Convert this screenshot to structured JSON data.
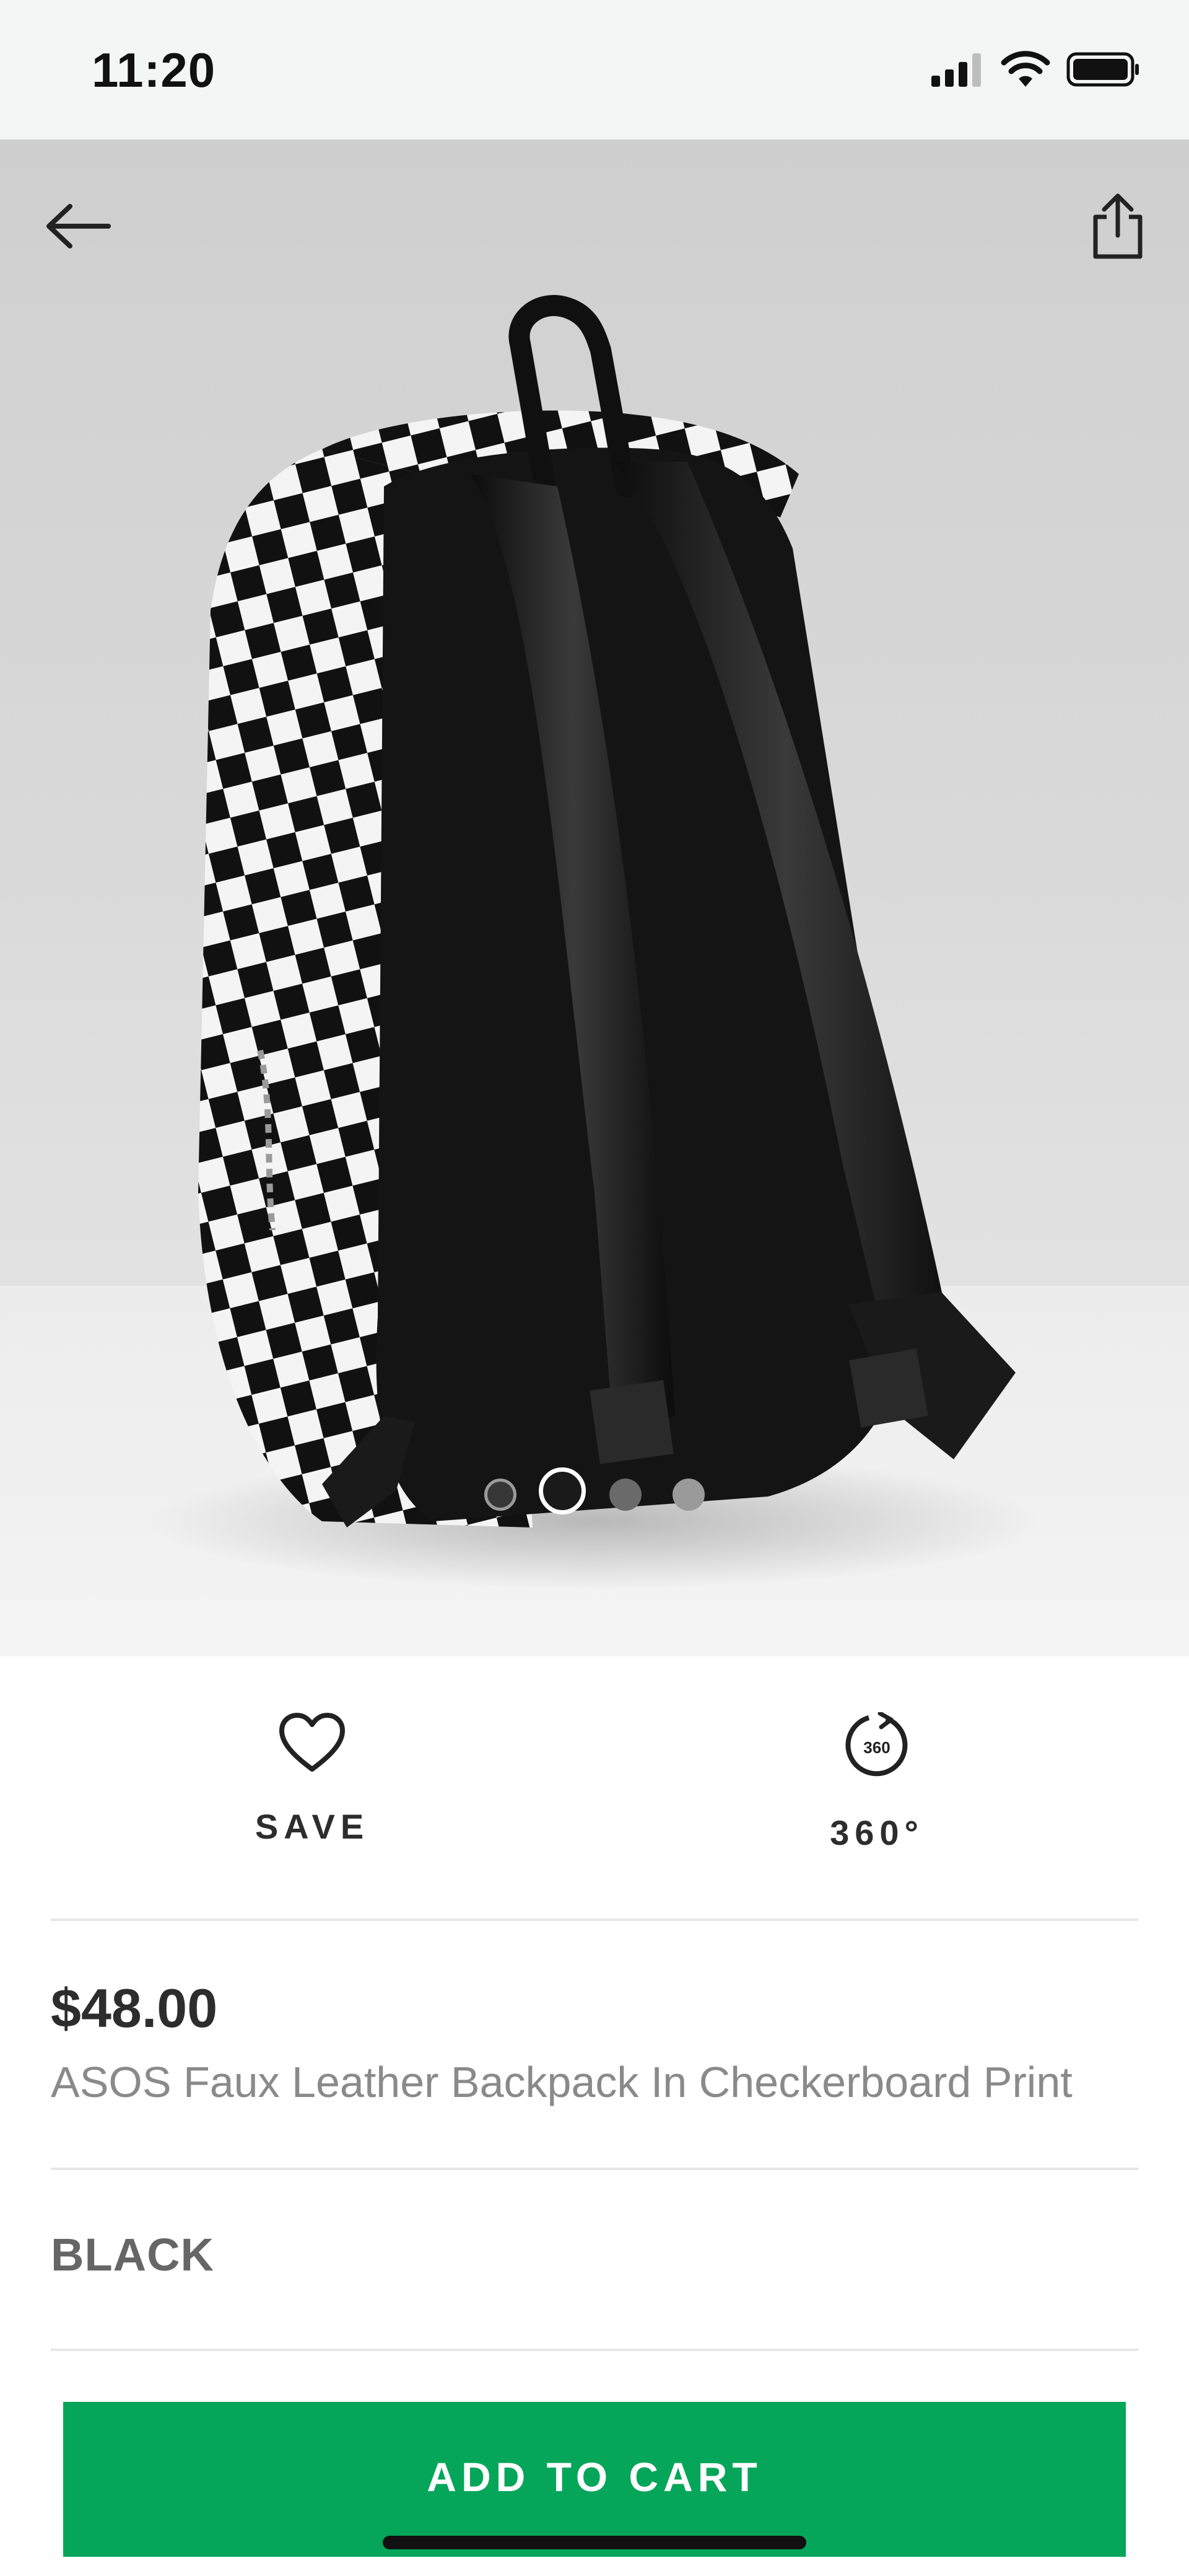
{
  "status_bar": {
    "time": "11:20",
    "icons": [
      "cellular-signal-icon",
      "wifi-icon",
      "battery-icon"
    ]
  },
  "product_image": {
    "nav_icons": [
      "back-arrow-icon",
      "share-icon"
    ],
    "carousel": {
      "total": 4,
      "active_index": 1
    }
  },
  "actions": {
    "save": {
      "label": "SAVE",
      "icon": "heart-icon"
    },
    "view360": {
      "label": "360°",
      "icon": "rotate-360-icon",
      "icon_text": "360"
    }
  },
  "product": {
    "price": "$48.00",
    "name": "ASOS Faux Leather Backpack In Checkerboard Print",
    "colour": "BLACK"
  },
  "cart": {
    "label": "ADD TO CART",
    "button_color": "#05a65a"
  }
}
